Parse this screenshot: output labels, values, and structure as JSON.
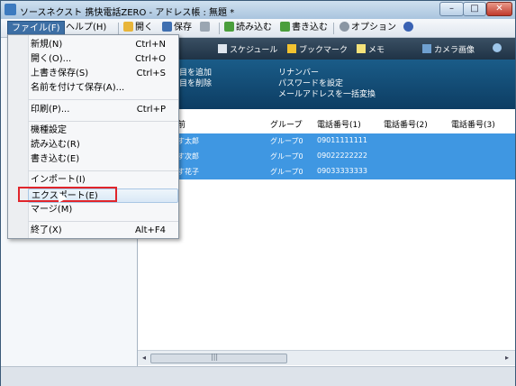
{
  "window": {
    "title": "ソースネクスト 携快電話ZERO - アドレス帳 : 無題 *",
    "min_label": "–",
    "max_label": "□",
    "close_label": "✕"
  },
  "menubar": {
    "file": "ファイル(F)",
    "help": "ヘルプ(H)",
    "open": "開く",
    "save": "保存",
    "read": "読み込む",
    "write": "書き込む",
    "options": "オプション"
  },
  "view_toolbar": {
    "schedule": "スケジュール",
    "bookmark": "ブックマーク",
    "memo": "メモ",
    "camera": "カメラ画像"
  },
  "ops": {
    "add_item": "目を追加",
    "delete_item": "目を削除",
    "renumber": "リナンバー",
    "set_password": "パスワードを設定",
    "convert_mail": "メールアドレスを一括変換"
  },
  "table": {
    "headers": [
      "前",
      "グループ",
      "電話番号(1)",
      "電話番号(2)",
      "電話番号(3)"
    ],
    "rows": [
      {
        "name": "す太郎",
        "group": "グループ0",
        "phone1": "09011111111"
      },
      {
        "name": "す次郎",
        "group": "グループ0",
        "phone1": "09022222222"
      },
      {
        "name": "す花子",
        "group": "グループ0",
        "phone1": "09033333333"
      }
    ]
  },
  "scroll": {
    "thumb_grip": "|||",
    "left": "◂",
    "right": "▸"
  },
  "file_menu": {
    "new": "新規(N)",
    "new_sc": "Ctrl+N",
    "open": "開く(O)...",
    "open_sc": "Ctrl+O",
    "overwrite": "上書き保存(S)",
    "overwrite_sc": "Ctrl+S",
    "save_as": "名前を付けて保存(A)...",
    "print": "印刷(P)...",
    "print_sc": "Ctrl+P",
    "device_settings": "機種設定",
    "read": "読み込む(R)",
    "write": "書き込む(E)",
    "import": "インポート(I)",
    "export": "エクスポート(E)",
    "merge": "マージ(M)",
    "exit": "終了(X)",
    "exit_sc": "Alt+F4"
  },
  "colors": {
    "highlight_row": "#3f97e2",
    "callout": "#e0252b",
    "menu_active": "#3d6fa5"
  }
}
